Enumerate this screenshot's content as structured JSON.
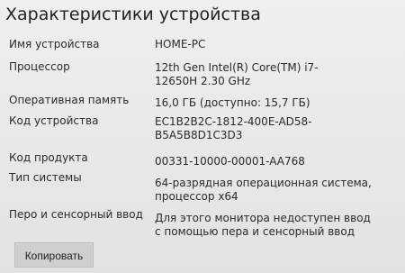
{
  "page": {
    "title": "Характеристики устройства"
  },
  "specs": [
    {
      "label": "Имя устройства",
      "value": "HOME-PC"
    },
    {
      "label": "Процессор",
      "value": "12th Gen Intel(R) Core(TM) i7-12650H   2.30 GHz"
    },
    {
      "label": "Оперативная память",
      "value": "16,0 ГБ (доступно: 15,7 ГБ)"
    },
    {
      "label": "Код устройства",
      "value": "EC1B2B2C-1812-400E-AD58-B5A5B8D1C3D3"
    },
    {
      "label": "Код продукта",
      "value": "00331-10000-00001-AA768"
    },
    {
      "label": "Тип системы",
      "value": "64-разрядная операционная система, процессор x64"
    },
    {
      "label": "Перо и сенсорный ввод",
      "value": "Для этого монитора недоступен ввод с помощью пера и сенсорный ввод"
    }
  ],
  "buttons": {
    "copy": "Копировать"
  }
}
